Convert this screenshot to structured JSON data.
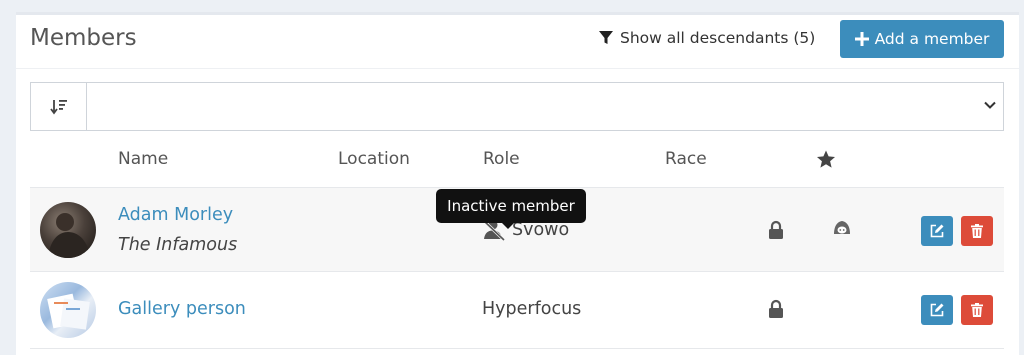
{
  "header": {
    "title": "Members",
    "filter_label": "Show all descendants (5)",
    "add_label": "Add a member"
  },
  "table": {
    "columns": [
      "Name",
      "Location",
      "Role",
      "Race"
    ],
    "rows": [
      {
        "name": "Adam Morley",
        "title": "The Infamous",
        "role": "Svowo",
        "inactive": true,
        "private": true,
        "has_race_icon": true
      },
      {
        "name": "Gallery person",
        "title": "",
        "role": "Hyperfocus",
        "inactive": false,
        "private": true,
        "has_race_icon": false
      }
    ]
  },
  "tooltip": {
    "text": "Inactive member"
  },
  "colors": {
    "primary": "#3c8dbc",
    "danger": "#dd4b39",
    "page_bg": "#ecf0f5"
  }
}
